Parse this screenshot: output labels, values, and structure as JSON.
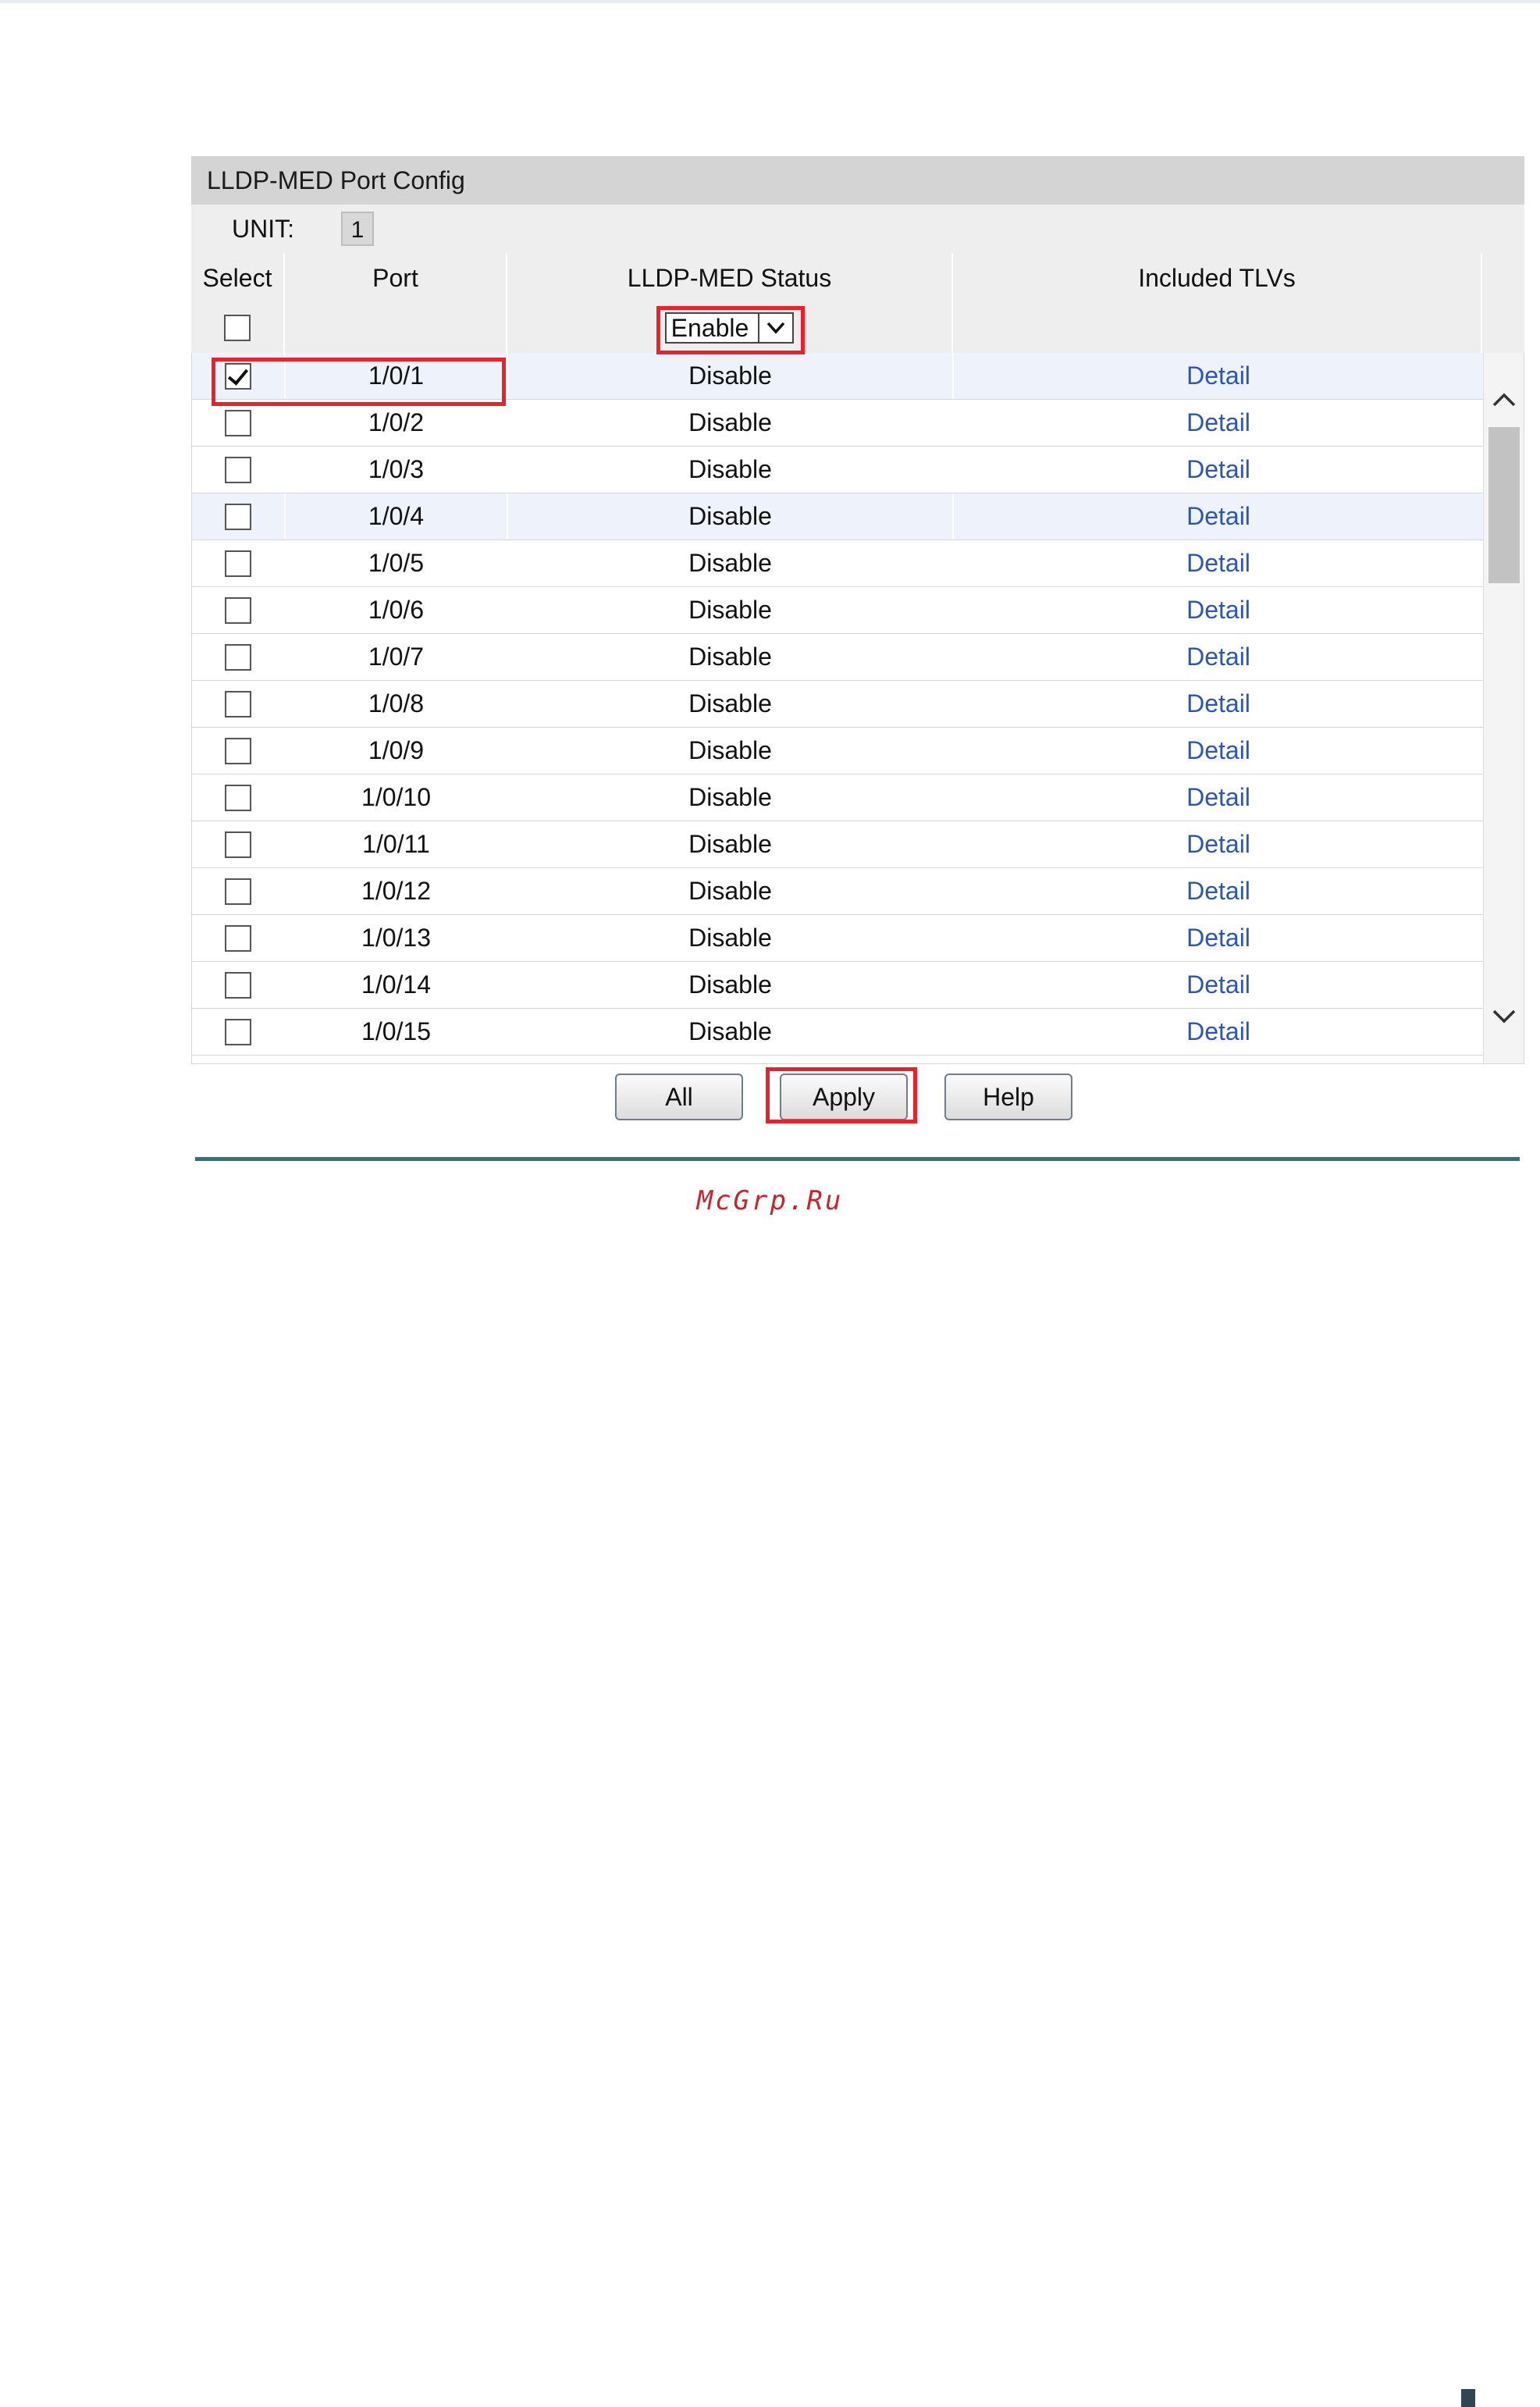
{
  "panel": {
    "title": "LLDP-MED Port Config",
    "unit_label": "UNIT:",
    "unit_value": "1"
  },
  "columns": {
    "select": "Select",
    "port": "Port",
    "status": "LLDP-MED Status",
    "tlvs": "Included TLVs"
  },
  "filter": {
    "status_value": "Enable"
  },
  "rows": [
    {
      "port": "1/0/1",
      "status": "Disable",
      "tlv": "Detail",
      "checked": true
    },
    {
      "port": "1/0/2",
      "status": "Disable",
      "tlv": "Detail",
      "checked": false
    },
    {
      "port": "1/0/3",
      "status": "Disable",
      "tlv": "Detail",
      "checked": false
    },
    {
      "port": "1/0/4",
      "status": "Disable",
      "tlv": "Detail",
      "checked": false
    },
    {
      "port": "1/0/5",
      "status": "Disable",
      "tlv": "Detail",
      "checked": false
    },
    {
      "port": "1/0/6",
      "status": "Disable",
      "tlv": "Detail",
      "checked": false
    },
    {
      "port": "1/0/7",
      "status": "Disable",
      "tlv": "Detail",
      "checked": false
    },
    {
      "port": "1/0/8",
      "status": "Disable",
      "tlv": "Detail",
      "checked": false
    },
    {
      "port": "1/0/9",
      "status": "Disable",
      "tlv": "Detail",
      "checked": false
    },
    {
      "port": "1/0/10",
      "status": "Disable",
      "tlv": "Detail",
      "checked": false
    },
    {
      "port": "1/0/11",
      "status": "Disable",
      "tlv": "Detail",
      "checked": false
    },
    {
      "port": "1/0/12",
      "status": "Disable",
      "tlv": "Detail",
      "checked": false
    },
    {
      "port": "1/0/13",
      "status": "Disable",
      "tlv": "Detail",
      "checked": false
    },
    {
      "port": "1/0/14",
      "status": "Disable",
      "tlv": "Detail",
      "checked": false
    },
    {
      "port": "1/0/15",
      "status": "Disable",
      "tlv": "Detail",
      "checked": false
    }
  ],
  "buttons": {
    "all": "All",
    "apply": "Apply",
    "help": "Help"
  },
  "watermark": "McGrp.Ru",
  "colors": {
    "highlight": "#e8212b",
    "link": "#2a56b5",
    "divider": "#3c6c75",
    "watermark": "#c4262e"
  }
}
